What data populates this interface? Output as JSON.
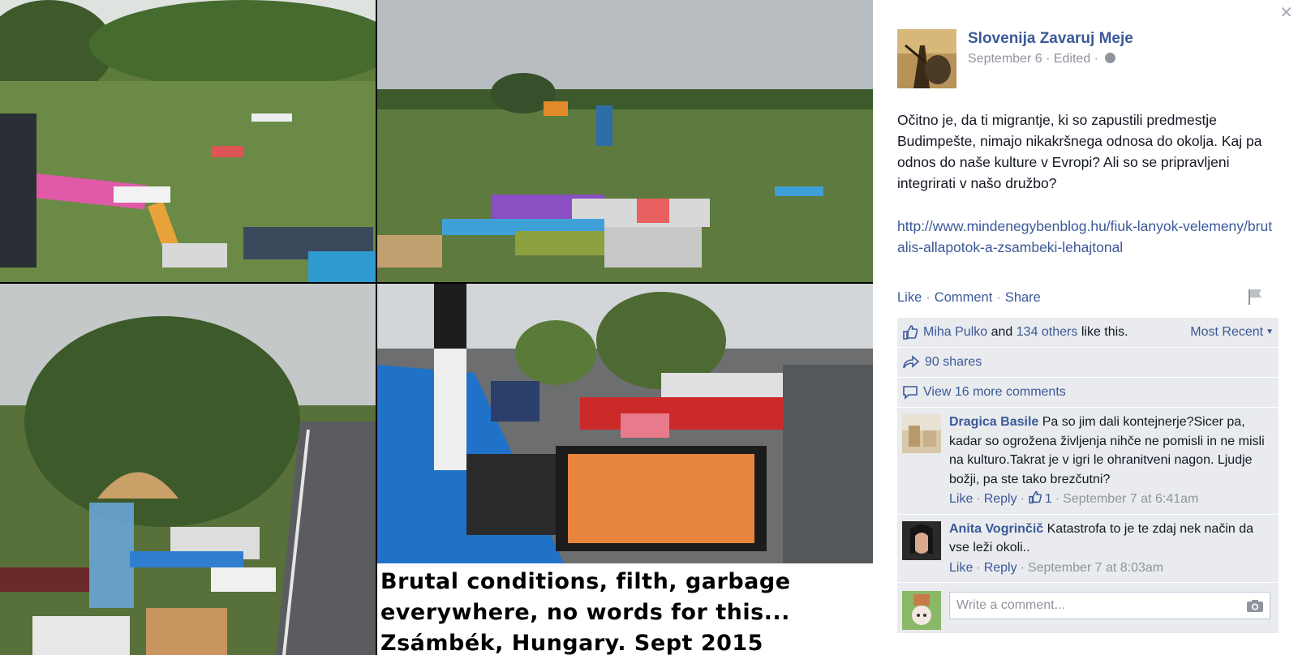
{
  "photo": {
    "caption_line1": "Brutal conditions, filth, garbage",
    "caption_line2": "everywhere, no words for this...",
    "caption_line3": "Zsámbék, Hungary. Sept 2015"
  },
  "post": {
    "page_name": "Slovenija Zavaruj Meje",
    "date": "September 6",
    "edited": "Edited",
    "text": "Očitno je, da ti migrantje, ki so zapustili predmestje Budimpešte, nimajo nikakršnega odnosa do okolja. Kaj pa odnos do naše kulture v Evropi? Ali so se pripravljeni integrirati v našo družbo?",
    "link": "http://www.mindenegybenblog.hu/fiuk-lanyok-velemeny/brutalis-allapotok-a-zsambeki-lehajtonal",
    "actions": {
      "like": "Like",
      "comment": "Comment",
      "share": "Share"
    }
  },
  "ufi": {
    "like_name": "Miha Pulko",
    "and": "and",
    "others": "134 others",
    "like_this": "like this.",
    "sort": "Most Recent",
    "shares": "90 shares",
    "view_more": "View 16 more comments"
  },
  "comments": [
    {
      "author": "Dragica Basile",
      "text": "Pa so jim dali kontejnerje?Sicer pa, kadar so ogrožena življenja nihče ne pomisli in ne misli na kulturo.Takrat je v igri le ohranitveni nagon. Ljudje božji, pa ste tako brezčutni?",
      "like": "Like",
      "reply": "Reply",
      "likes": "1",
      "time": "September 7 at 6:41am"
    },
    {
      "author": "Anita Vogrinčič",
      "text": "Katastrofa to je te zdaj nek način da vse leži okoli..",
      "like": "Like",
      "reply": "Reply",
      "time": "September 7 at 8:03am"
    }
  ],
  "write_comment": {
    "placeholder": "Write a comment..."
  },
  "icons": {
    "close": "close-icon",
    "globe": "globe-icon",
    "flag": "flag-icon",
    "thumbs_up": "thumbs-up-icon",
    "share": "share-icon",
    "comment": "comment-bubble-icon",
    "camera": "camera-icon"
  },
  "colors": {
    "link": "#3b5998",
    "muted": "#90949c",
    "ufi_bg": "#e9ebee"
  }
}
